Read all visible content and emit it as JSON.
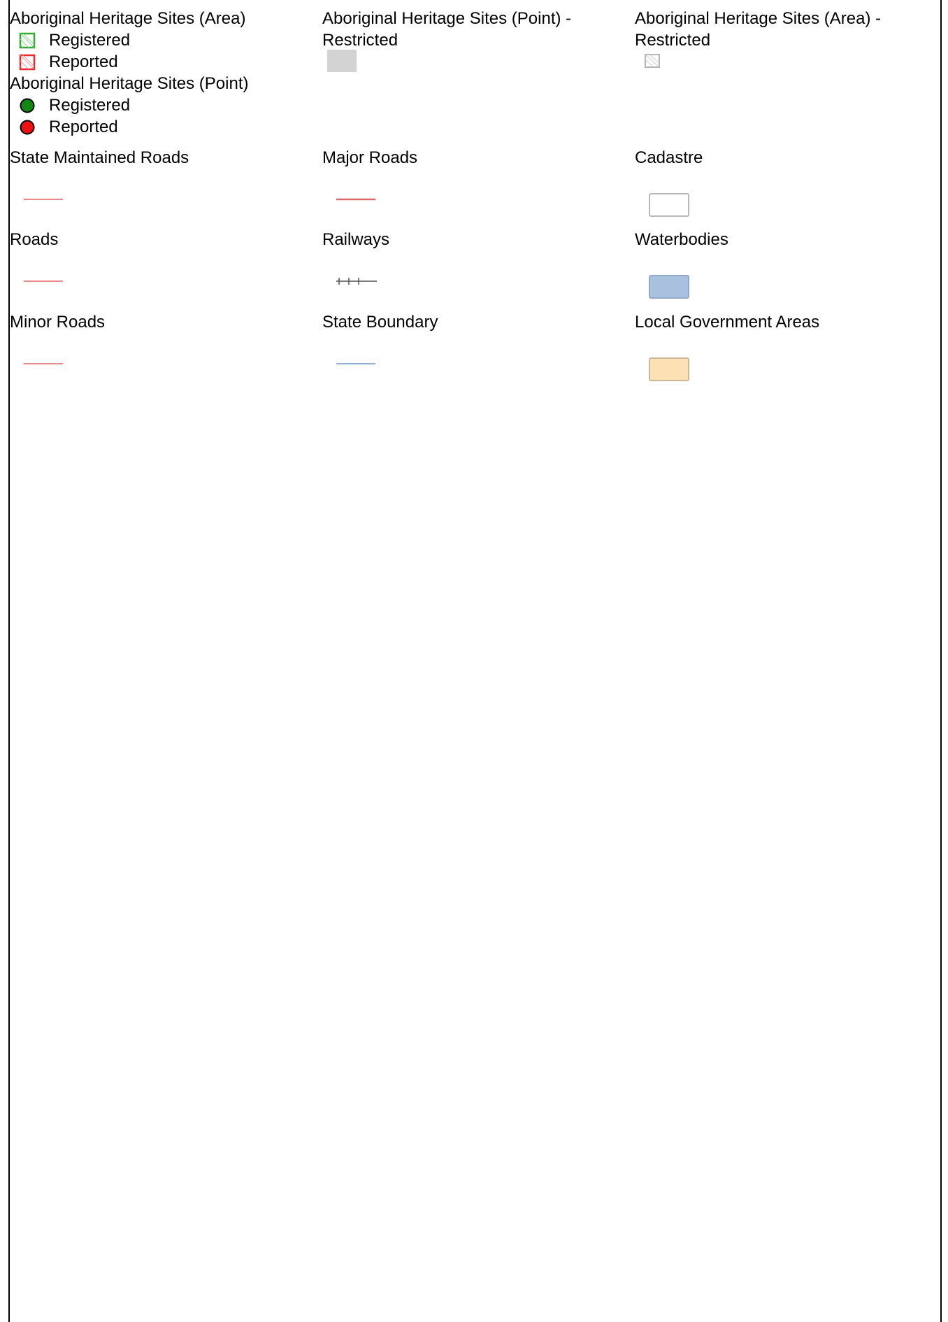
{
  "legend": {
    "ahs_area": {
      "title": "Aboriginal Heritage Sites (Area)",
      "items": [
        {
          "label": "Registered",
          "icon": "hatched-square-icon",
          "color": "#2eaa2e"
        },
        {
          "label": "Reported",
          "icon": "hatched-square-icon",
          "color": "#e8282a"
        }
      ]
    },
    "ahs_point": {
      "title": "Aboriginal Heritage Sites (Point)",
      "items": [
        {
          "label": "Registered",
          "icon": "circle-icon",
          "color": "#118811"
        },
        {
          "label": "Reported",
          "icon": "circle-icon",
          "color": "#ee1111"
        }
      ]
    },
    "ahs_point_restricted": {
      "title": "Aboriginal Heritage Sites (Point) - Restricted",
      "icon": "grey-square-icon",
      "color": "#d3d3d3"
    },
    "ahs_area_restricted": {
      "title": "Aboriginal Heritage Sites (Area) - Restricted",
      "icon": "hatched-square-icon",
      "color": "#b5b5b5"
    },
    "state_maintained_roads": {
      "title": "State Maintained Roads",
      "icon": "line-icon",
      "color": "#e98a8a"
    },
    "major_roads": {
      "title": "Major Roads",
      "icon": "line-icon",
      "color": "#e06a6a"
    },
    "cadastre": {
      "title": "Cadastre",
      "icon": "rectangle-icon",
      "fill": "#ffffff",
      "stroke": "#b8b8b8"
    },
    "roads": {
      "title": "Roads",
      "icon": "line-icon",
      "color": "#e98a8a"
    },
    "railways": {
      "title": "Railways",
      "icon": "railway-icon",
      "color": "#555555"
    },
    "waterbodies": {
      "title": "Waterbodies",
      "icon": "rectangle-icon",
      "fill": "#a9c1df",
      "stroke": "#8fa9c6"
    },
    "minor_roads": {
      "title": "Minor Roads",
      "icon": "line-icon",
      "color": "#e98a8a"
    },
    "state_boundary": {
      "title": "State Boundary",
      "icon": "line-icon",
      "color": "#8eb2d8"
    },
    "lga": {
      "title": "Local Government Areas",
      "icon": "rectangle-icon",
      "fill": "#fde0b3",
      "stroke": "#cdb797"
    }
  }
}
